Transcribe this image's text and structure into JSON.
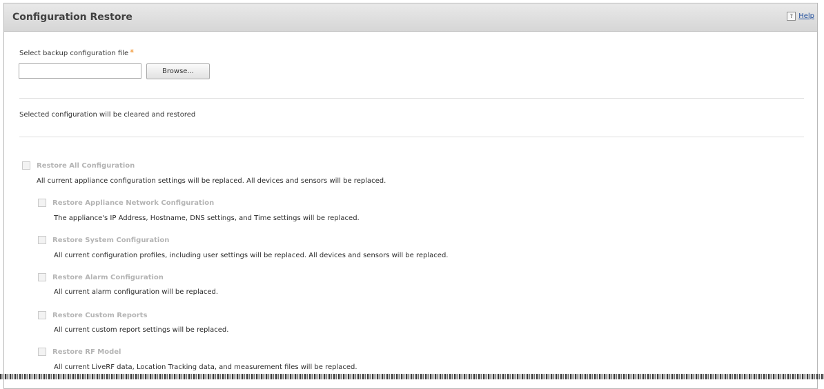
{
  "panel": {
    "title": "Configuration Restore",
    "help_icon": "?",
    "help_label": "Help"
  },
  "file_select": {
    "label": "Select backup configuration file",
    "required_marker": "*",
    "value": "",
    "browse_label": "Browse..."
  },
  "note": "Selected configuration will be cleared and restored",
  "options": [
    {
      "label": "Restore All Configuration",
      "desc": "All current appliance configuration settings will be replaced. All devices and sensors will be replaced.",
      "checked": false
    },
    {
      "label": "Restore Appliance Network Configuration",
      "desc": "The appliance's IP Address, Hostname, DNS settings, and Time settings will be replaced.",
      "checked": false
    },
    {
      "label": "Restore System Configuration",
      "desc": "All current configuration profiles, including user settings will be replaced. All devices and sensors will be replaced.",
      "checked": false
    },
    {
      "label": "Restore Alarm Configuration",
      "desc": "All current alarm configuration will be replaced.",
      "checked": false
    },
    {
      "label": "Restore Custom Reports",
      "desc": "All current custom report settings will be replaced.",
      "checked": false
    },
    {
      "label": "Restore RF Model",
      "desc": "All current LiveRF data, Location Tracking data, and measurement files will be replaced.",
      "checked": false
    }
  ]
}
